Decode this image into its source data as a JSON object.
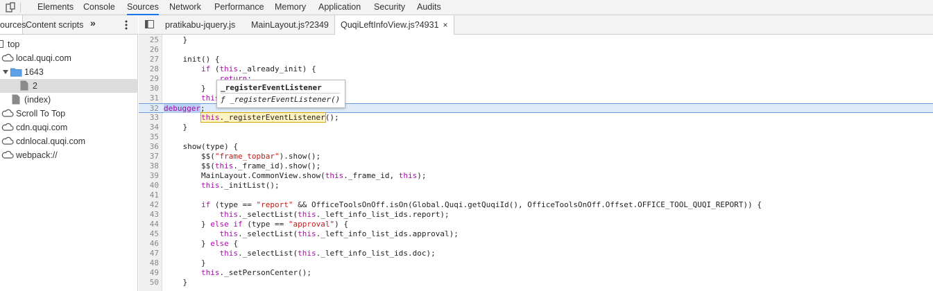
{
  "topbar": {
    "tabs": [
      {
        "label": "Elements"
      },
      {
        "label": "Console"
      },
      {
        "label": "Sources"
      },
      {
        "label": "Network"
      },
      {
        "label": "Performance"
      },
      {
        "label": "Memory"
      },
      {
        "label": "Application"
      },
      {
        "label": "Security"
      },
      {
        "label": "Audits"
      }
    ],
    "active_tab": "Sources",
    "accent": "#1a73e8"
  },
  "sidebar": {
    "tabs": [
      {
        "label": "ources"
      },
      {
        "label": "Content scripts"
      }
    ],
    "more_label": "»",
    "tree": [
      {
        "label": "top",
        "icon": "frame-icon"
      },
      {
        "label": "local.quqi.com",
        "icon": "cloud-icon"
      },
      {
        "label": "1643",
        "icon": "folder-icon",
        "expanded": true
      },
      {
        "label": "2",
        "icon": "file-icon",
        "selected": true
      },
      {
        "label": "(index)",
        "icon": "file-icon"
      },
      {
        "label": "Scroll To Top",
        "icon": "cloud-icon"
      },
      {
        "label": "cdn.quqi.com",
        "icon": "cloud-icon"
      },
      {
        "label": "cdnlocal.quqi.com",
        "icon": "cloud-icon"
      },
      {
        "label": "webpack://",
        "icon": "cloud-icon"
      }
    ]
  },
  "editor": {
    "tabs": [
      {
        "label": "pratikabu-jquery.js"
      },
      {
        "label": "MainLayout.js?2349"
      },
      {
        "label": "QuqiLeftInfoView.js?4931",
        "active": true
      }
    ],
    "close_label": "×",
    "tooltip": {
      "title": "_registerEventListener",
      "signature": "ƒ _registerEventListener()"
    },
    "lines": [
      {
        "n": "25",
        "code": "    }"
      },
      {
        "n": "26",
        "code": ""
      },
      {
        "n": "27",
        "code": "    init() {"
      },
      {
        "n": "28",
        "code": "        if (this._already_init) {"
      },
      {
        "n": "29",
        "code": "            return;"
      },
      {
        "n": "30",
        "code": "        }"
      },
      {
        "n": "31",
        "code": "        this._already_init = true;"
      },
      {
        "n": "32",
        "code": "debugger;"
      },
      {
        "n": "33",
        "code": "        this._registerEventListener();"
      },
      {
        "n": "34",
        "code": "    }"
      },
      {
        "n": "35",
        "code": ""
      },
      {
        "n": "36",
        "code": "    show(type) {"
      },
      {
        "n": "37",
        "code": "        $$(\"frame_topbar\").show();"
      },
      {
        "n": "38",
        "code": "        $$(this._frame_id).show();"
      },
      {
        "n": "39",
        "code": "        MainLayout.CommonView.show(this._frame_id, this);"
      },
      {
        "n": "40",
        "code": "        this._initList();"
      },
      {
        "n": "41",
        "code": ""
      },
      {
        "n": "42",
        "code": "        if (type == \"report\" && OfficeToolsOnOff.isOn(Global.Quqi.getQuqiId(), OfficeToolsOnOff.Offset.OFFICE_TOOL_QUQI_REPORT)) {"
      },
      {
        "n": "43",
        "code": "            this._selectList(this._left_info_list_ids.report);"
      },
      {
        "n": "44",
        "code": "        } else if (type == \"approval\") {"
      },
      {
        "n": "45",
        "code": "            this._selectList(this._left_info_list_ids.approval);"
      },
      {
        "n": "46",
        "code": "        } else {"
      },
      {
        "n": "47",
        "code": "            this._selectList(this._left_info_list_ids.doc);"
      },
      {
        "n": "48",
        "code": "        }"
      },
      {
        "n": "49",
        "code": "        this._setPersonCenter();"
      },
      {
        "n": "50",
        "code": "    }"
      }
    ]
  }
}
